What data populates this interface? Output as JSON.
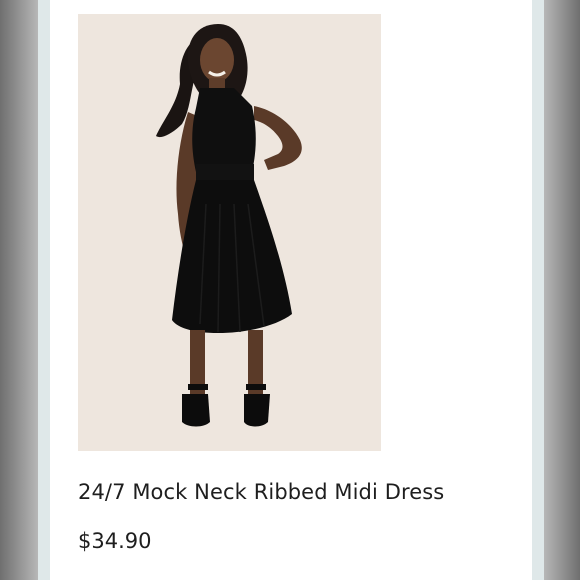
{
  "product": {
    "title": "24/7 Mock Neck Ribbed Midi Dress",
    "price": "$34.90",
    "image_subject": "model wearing black sleeveless mock neck ribbed midi dress"
  },
  "colors": {
    "image_background": "#eee6de",
    "dress": "#0f0f0f",
    "frame": "#9a9a9a",
    "bezel": "#dfe8e9"
  }
}
